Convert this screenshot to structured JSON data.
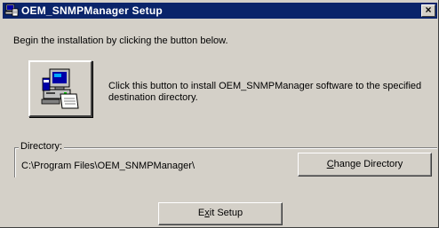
{
  "window": {
    "title": "OEM_SNMPManager Setup",
    "close_glyph": "×"
  },
  "main": {
    "intro": "Begin the installation by clicking the button below.",
    "install_button_icon": "setup-computer-icon",
    "install_description": "Click this button to install OEM_SNMPManager software to the specified destination directory."
  },
  "directory": {
    "label": "Directory:",
    "path": "C:\\Program Files\\OEM_SNMPManager\\",
    "change_button": {
      "hotkey": "C",
      "rest": "hange Directory"
    }
  },
  "footer": {
    "exit_button": {
      "pre": "E",
      "hotkey": "x",
      "post": "it Setup"
    }
  },
  "colors": {
    "titlebar": "#0a246a",
    "face": "#d4d0c8"
  }
}
